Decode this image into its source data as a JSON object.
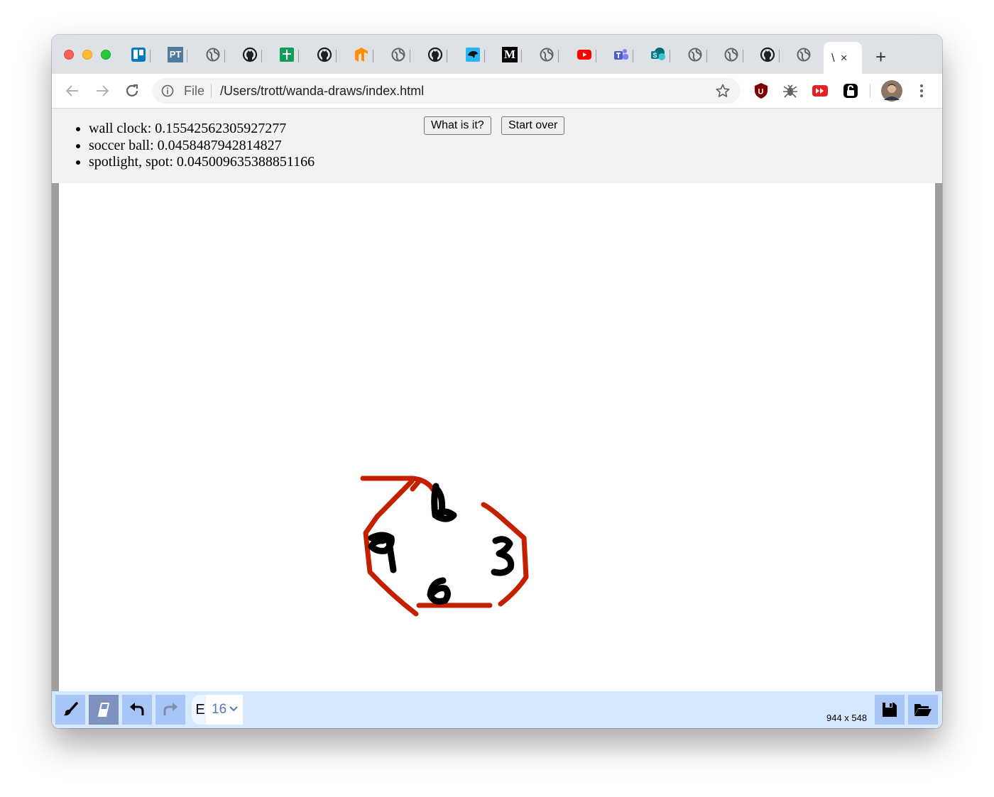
{
  "browser": {
    "active_tab_title": "\\",
    "active_tab_close": "×",
    "new_tab": "+",
    "address": {
      "scheme_label": "File",
      "url": "/Users/trott/wanda-draws/index.html"
    },
    "tabs": [
      {
        "icon": "trello-icon"
      },
      {
        "icon": "pivotal-tracker-icon",
        "text": "PT"
      },
      {
        "icon": "globe-icon"
      },
      {
        "icon": "github-icon"
      },
      {
        "icon": "google-sheets-icon"
      },
      {
        "icon": "github-icon"
      },
      {
        "icon": "tensorflow-icon"
      },
      {
        "icon": "globe-icon"
      },
      {
        "icon": "github-icon"
      },
      {
        "icon": "bird-icon"
      },
      {
        "icon": "medium-icon",
        "text": "M"
      },
      {
        "icon": "globe-icon"
      },
      {
        "icon": "youtube-icon"
      },
      {
        "icon": "teams-icon"
      },
      {
        "icon": "sharepoint-icon"
      },
      {
        "icon": "globe-icon"
      },
      {
        "icon": "globe-icon"
      },
      {
        "icon": "github-icon"
      },
      {
        "icon": "globe-icon"
      }
    ],
    "extensions": [
      {
        "icon": "ublock-icon",
        "text": "U"
      },
      {
        "icon": "bug-icon"
      },
      {
        "icon": "fast-forward-icon"
      },
      {
        "icon": "lock-icon"
      }
    ]
  },
  "page": {
    "predictions": [
      {
        "text": "wall clock: 0.15542562305927277"
      },
      {
        "text": "soccer ball: 0.0458487942814827"
      },
      {
        "text": "spotlight, spot: 0.045009635388851166"
      }
    ],
    "what_button": "What is it?",
    "start_over_button": "Start over",
    "drawing": {
      "octagon_color": "#c42000",
      "digit_color": "#000000",
      "digits": [
        "6",
        "9",
        "3",
        "6"
      ]
    },
    "toolbar": {
      "brush_letter": "E",
      "brush_size": "16",
      "canvas_dims": "944 x 548",
      "accent": "#a8c5f7",
      "active_tool": "eraser"
    }
  }
}
